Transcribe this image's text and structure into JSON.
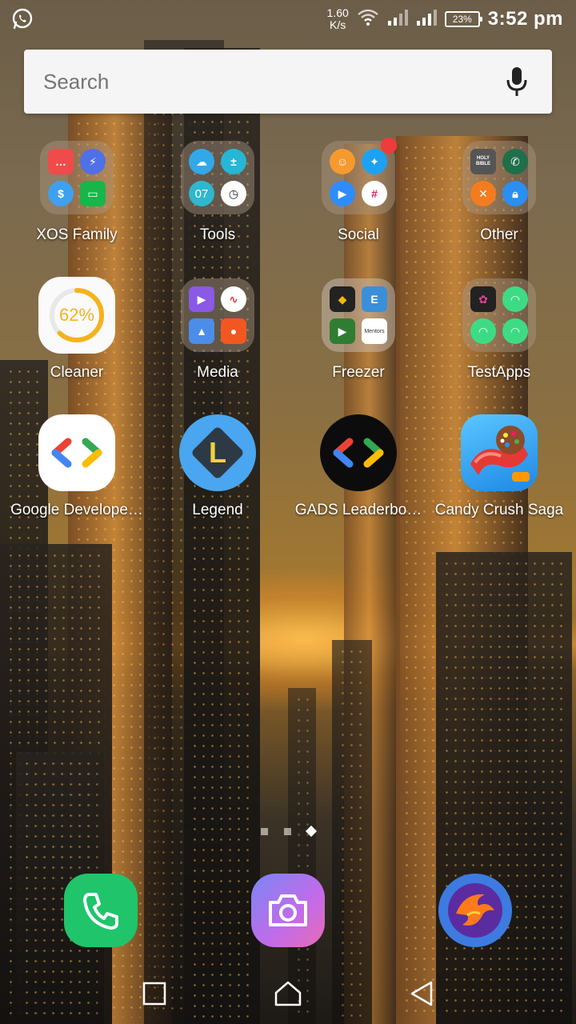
{
  "status_bar": {
    "notification_icon": "whatsapp-icon",
    "net_speed_value": "1.60",
    "net_speed_unit": "K/s",
    "battery_percent": "23%",
    "time": "3:52 pm"
  },
  "search": {
    "placeholder": "Search",
    "mic_icon": "mic-icon"
  },
  "apps": {
    "xos_family": {
      "label": "XOS Family",
      "type": "folder"
    },
    "tools": {
      "label": "Tools",
      "type": "folder",
      "mini_text": "07"
    },
    "social": {
      "label": "Social",
      "type": "folder"
    },
    "other": {
      "label": "Other",
      "type": "folder",
      "mini_text": "HOLY BIBLE"
    },
    "cleaner": {
      "label": "Cleaner",
      "percent": "62%",
      "progress": 0.62
    },
    "media": {
      "label": "Media",
      "type": "folder"
    },
    "freezer": {
      "label": "Freezer",
      "type": "folder",
      "mini_text": "Mentors"
    },
    "testapps": {
      "label": "TestApps",
      "type": "folder"
    },
    "google_developers": {
      "label": "Google Develope…"
    },
    "legend": {
      "label": "Legend",
      "letter": "L"
    },
    "gads": {
      "label": "GADS Leaderbo…"
    },
    "candy_crush": {
      "label": "Candy Crush Saga"
    }
  },
  "pages": {
    "count": 3,
    "current": 3
  },
  "dock": [
    "phone-icon",
    "camera-icon",
    "phoenix-browser-icon"
  ],
  "nav": [
    "recents-icon",
    "home-icon",
    "back-icon"
  ],
  "colors": {
    "search_bg": "#f5f5f5",
    "phone_green": "#1fc46b",
    "cleaner_ring": "#f5b21e",
    "legend_blue": "#4aa6f0"
  }
}
